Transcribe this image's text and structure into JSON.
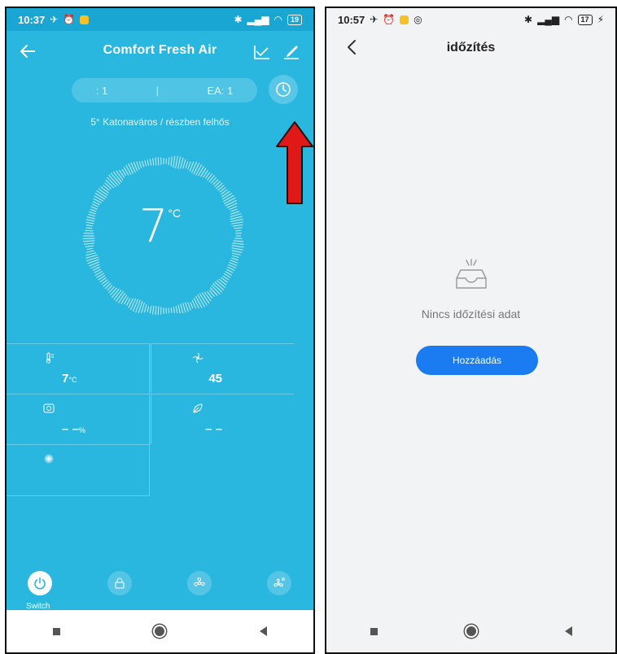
{
  "left": {
    "status": {
      "time": "10:37",
      "battery": "19"
    },
    "header": {
      "title": "Comfort  Fresh Air"
    },
    "ea_bar": {
      "left_value": ": 1",
      "separator": "|",
      "right_value": "EA: 1"
    },
    "weather": "5°  Katonaváros  /  részben felhős",
    "temperature": {
      "value": "7",
      "unit": "°C"
    },
    "grid": [
      {
        "icon": "thermometer-icon",
        "value": "7",
        "unit": "°C"
      },
      {
        "icon": "fan-speed-icon",
        "value": "45",
        "unit": ""
      },
      {
        "icon": "humidity-icon",
        "value": "– –",
        "unit": "%"
      },
      {
        "icon": "leaf-icon",
        "value": "– –",
        "unit": ""
      },
      {
        "icon": "snowflake-icon",
        "value": "",
        "unit": ""
      }
    ],
    "controls": {
      "power_label": "Switch"
    }
  },
  "right": {
    "status": {
      "time": "10:57",
      "battery": "17"
    },
    "header": {
      "title": "időzítés"
    },
    "empty_text": "Nincs időzítési adat",
    "add_button": "Hozzáadás"
  },
  "colors": {
    "left_bg": "#2ab7df",
    "accent_blue": "#1a7cf0",
    "arrow_red": "#e01818"
  }
}
